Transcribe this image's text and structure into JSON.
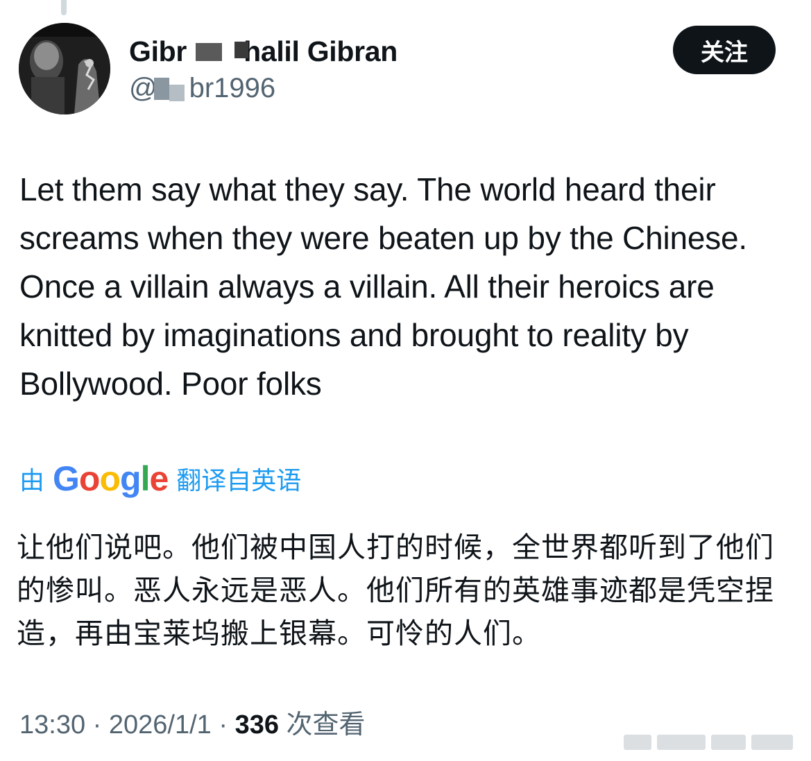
{
  "user": {
    "display_name": "Gibran Khalil Gibran",
    "display_name_visible_left": "Gibr",
    "display_name_visible_right": "halil Gibran",
    "handle_prefix": "@",
    "handle_suffix": "br1996"
  },
  "follow_button": {
    "label": "关注"
  },
  "tweet": {
    "text": "Let them say what they say. The world heard their screams when they were beaten up by the Chinese. Once a villain always a villain. All their heroics are knitted by imaginations and brought to reality by Bollywood. Poor folks"
  },
  "translation": {
    "prefix": "由",
    "provider": "Google",
    "suffix": "翻译自英语",
    "text": "让他们说吧。他们被中国人打的时候，全世界都听到了他们的惨叫。恶人永远是恶人。他们所有的英雄事迹都是凭空捏造，再由宝莱坞搬上银幕。可怜的人们。"
  },
  "meta": {
    "time": "13:30",
    "separator": " · ",
    "date": "2026/1/1",
    "views_count": "336",
    "views_label": " 次查看"
  },
  "colors": {
    "text_primary": "#0f1419",
    "text_secondary": "#536471",
    "link_blue": "#1d9bf0",
    "button_bg": "#0f1419"
  },
  "icons": {
    "avatar": "user-avatar-photo"
  }
}
